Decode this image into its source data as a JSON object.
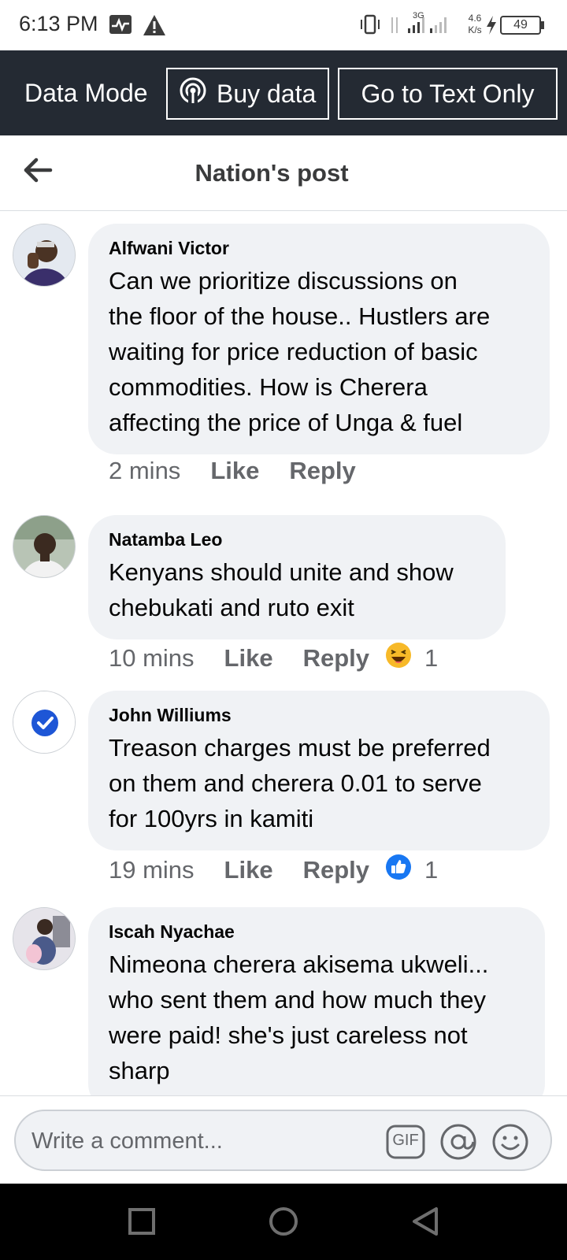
{
  "status_bar": {
    "time": "6:13 PM",
    "network_type": "3G",
    "speed_value": "4.6",
    "speed_unit": "K/s",
    "battery": "49",
    "icons": [
      "activity-icon",
      "warning-icon",
      "vibrate-icon",
      "signal-icon",
      "charging-icon",
      "battery-icon"
    ]
  },
  "data_bar": {
    "mode_label": "Data Mode",
    "buy_label": "Buy data",
    "text_only_label": "Go to Text Only"
  },
  "header": {
    "title": "Nation's post"
  },
  "comments": [
    {
      "name": "Alfwani Victor",
      "lines": [
        "Can we prioritize discussions on",
        "the floor of the house.. Hustlers are",
        "waiting for price reduction of basic",
        "commodities. How is Cherera",
        "affecting the price of Unga & fuel"
      ],
      "time": "2 mins",
      "like": "Like",
      "reply": "Reply"
    },
    {
      "name": "Natamba Leo",
      "lines": [
        "Kenyans should unite and show",
        "chebukati and ruto exit"
      ],
      "time": "10 mins",
      "like": "Like",
      "reply": "Reply",
      "reaction": "haha",
      "reaction_count": "1"
    },
    {
      "name": "John Williums",
      "lines": [
        "Treason charges must be preferred",
        "on them and cherera 0.01 to serve",
        "for 100yrs in kamiti"
      ],
      "time": "19 mins",
      "like": "Like",
      "reply": "Reply",
      "reaction": "like",
      "reaction_count": "1"
    },
    {
      "name": "Iscah Nyachae",
      "lines": [
        "Nimeona cherera akisema ukweli...",
        "who sent them and how much they",
        "were paid! she's just careless not",
        "sharp"
      ]
    }
  ],
  "composer": {
    "placeholder": "Write a comment...",
    "gif_label": "GIF"
  },
  "colors": {
    "data_bar_bg": "#242a33",
    "bubble_bg": "#f0f2f5",
    "meta_text": "#65676b",
    "like_blue": "#1877f2",
    "haha_yellow": "#f7b928",
    "nav_bg": "#000000"
  }
}
